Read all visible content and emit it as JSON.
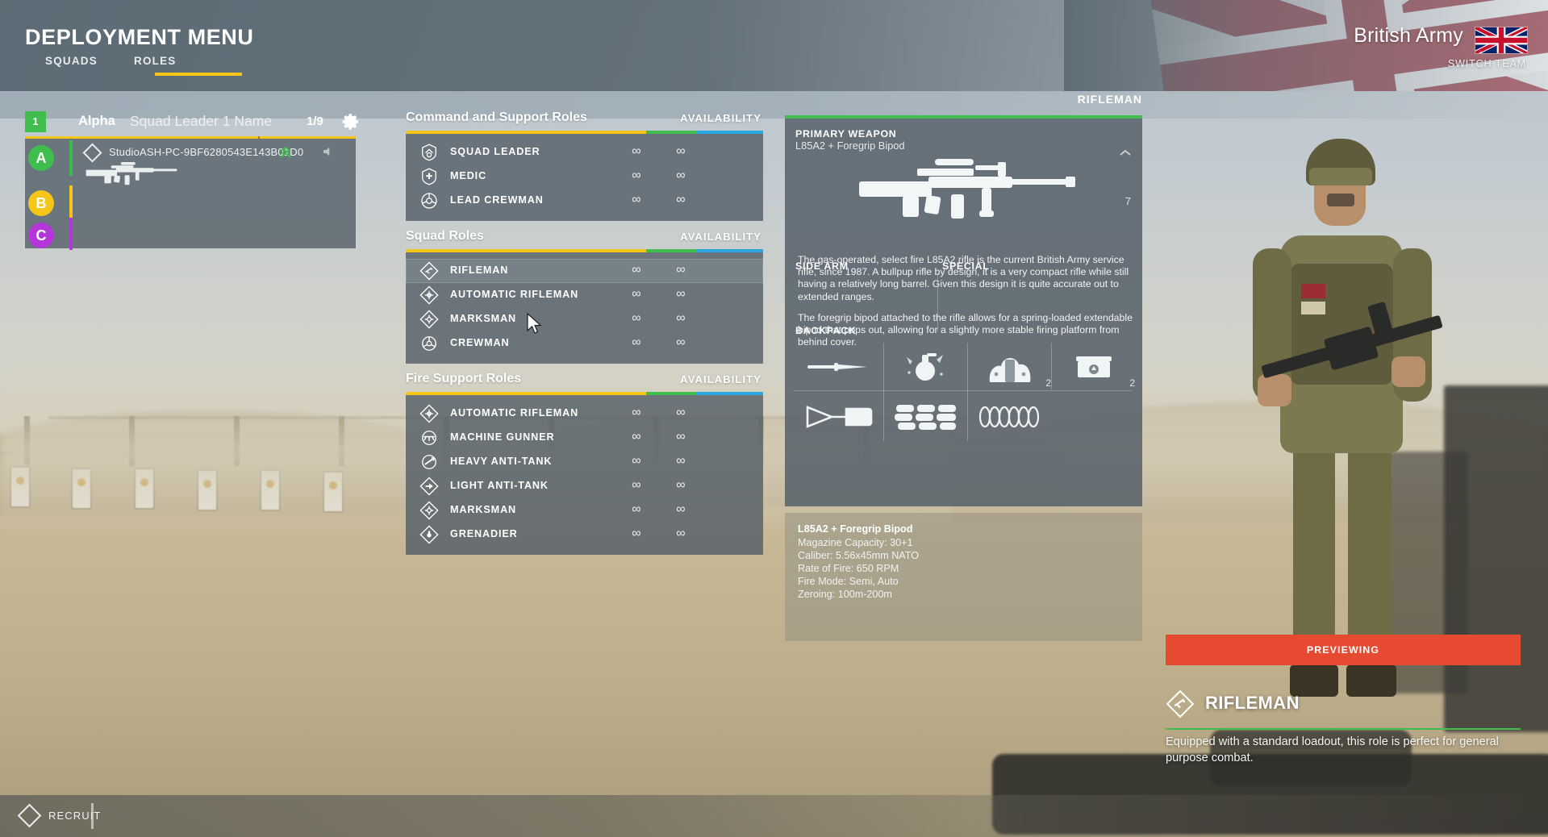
{
  "header": {
    "title": "DEPLOYMENT MENU",
    "tabs": [
      {
        "id": "squads",
        "label": "SQUADS",
        "active": false
      },
      {
        "id": "roles",
        "label": "ROLES",
        "active": true
      }
    ],
    "team_name": "British Army",
    "team_flag_icon": "union-jack-flag-icon",
    "switch_team_label": "SWITCH TEAM"
  },
  "squad_panel": {
    "squad_number": "1",
    "squad_name": "Alpha",
    "leader_label": "Squad Leader 1 Name",
    "capacity": "1/9",
    "settings_icon": "gear-icon",
    "fireteams": [
      {
        "letter": "A",
        "color": "#3fbe4d"
      },
      {
        "letter": "B",
        "color": "#f5c518"
      },
      {
        "letter": "C",
        "color": "#b336d8"
      }
    ],
    "members": [
      {
        "fireteam": "A",
        "name": "StudioASH-PC-9BF6280543E143B01D0",
        "rank_icon": "chevron-rank-icon",
        "mute_icon": "speaker-icon",
        "weapon_icon": "rifle-silhouette-icon"
      }
    ]
  },
  "role_sections": [
    {
      "id": "command-and-support",
      "title": "Command and Support Roles",
      "availability_label": "AVAILABILITY",
      "roles": [
        {
          "name": "SQUAD LEADER",
          "icon": "squad-leader-icon",
          "avail_1": "∞",
          "avail_2": "∞",
          "selected": false
        },
        {
          "name": "MEDIC",
          "icon": "medic-icon",
          "avail_1": "∞",
          "avail_2": "∞",
          "selected": false
        },
        {
          "name": "LEAD CREWMAN",
          "icon": "lead-crewman-icon",
          "avail_1": "∞",
          "avail_2": "∞",
          "selected": false
        }
      ]
    },
    {
      "id": "squad-roles",
      "title": "Squad Roles",
      "availability_label": "AVAILABILITY",
      "roles": [
        {
          "name": "RIFLEMAN",
          "icon": "rifleman-icon",
          "avail_1": "∞",
          "avail_2": "∞",
          "selected": true
        },
        {
          "name": "AUTOMATIC RIFLEMAN",
          "icon": "automatic-rifleman-icon",
          "avail_1": "∞",
          "avail_2": "∞",
          "selected": false
        },
        {
          "name": "MARKSMAN",
          "icon": "marksman-icon",
          "avail_1": "∞",
          "avail_2": "∞",
          "selected": false
        },
        {
          "name": "CREWMAN",
          "icon": "crewman-icon",
          "avail_1": "∞",
          "avail_2": "∞",
          "selected": false
        }
      ]
    },
    {
      "id": "fire-support-roles",
      "title": "Fire Support Roles",
      "availability_label": "AVAILABILITY",
      "roles": [
        {
          "name": "AUTOMATIC RIFLEMAN",
          "icon": "automatic-rifleman-icon",
          "avail_1": "∞",
          "avail_2": "∞",
          "selected": false
        },
        {
          "name": "MACHINE GUNNER",
          "icon": "machine-gunner-icon",
          "avail_1": "∞",
          "avail_2": "∞",
          "selected": false
        },
        {
          "name": "HEAVY ANTI-TANK",
          "icon": "heavy-anti-tank-icon",
          "avail_1": "∞",
          "avail_2": "∞",
          "selected": false
        },
        {
          "name": "LIGHT ANTI-TANK",
          "icon": "light-anti-tank-icon",
          "avail_1": "∞",
          "avail_2": "∞",
          "selected": false
        },
        {
          "name": "MARKSMAN",
          "icon": "marksman-icon",
          "avail_1": "∞",
          "avail_2": "∞",
          "selected": false
        },
        {
          "name": "GRENADIER",
          "icon": "grenadier-icon",
          "avail_1": "∞",
          "avail_2": "∞",
          "selected": false
        }
      ]
    }
  ],
  "loadout": {
    "role_title": "RIFLEMAN",
    "primary_label": "PRIMARY WEAPON",
    "primary_name": "L85A2 + Foregrip Bipod",
    "primary_weapon_icon": "rifle-l85a2-icon",
    "collapse_icon": "chevron-up-icon",
    "primary_slot_count": "7",
    "side_arm_label": "SIDE ARM",
    "special_label": "SPECIAL",
    "backpack_label": "BACKPACK",
    "backpack_items": [
      {
        "icon": "knife-icon",
        "qty": ""
      },
      {
        "icon": "frag-grenade-icon",
        "qty": ""
      },
      {
        "icon": "smoke-grenade-icon",
        "qty": "2"
      },
      {
        "icon": "ammo-bag-icon",
        "qty": "2"
      },
      {
        "icon": "shovel-icon",
        "qty": ""
      },
      {
        "icon": "sandbags-icon",
        "qty": ""
      },
      {
        "icon": "razor-wire-icon",
        "qty": ""
      }
    ],
    "weapon_info": {
      "title": "L85A2 + Foregrip Bipod",
      "stats": [
        "Magazine Capacity: 30+1",
        "Caliber: 5.56x45mm NATO",
        "Rate of Fire: 650 RPM",
        "Fire Mode: Semi, Auto",
        "Zeroing: 100m-200m"
      ],
      "paragraph_1": "The gas-operated, select fire L85A2 rifle is the current British Army service rifle, since 1987. A bullpup rifle by design, it is a very compact rifle while still having a relatively long barrel. Given this design it is quite accurate out to extended ranges.",
      "paragraph_2": "The foregrip bipod attached to the rifle allows for a spring-loaded extendable bipod that pops out, allowing for a slightly more stable firing platform from behind cover."
    }
  },
  "preview": {
    "button_label": "PREVIEWING",
    "button_color": "#e64a31",
    "role_name": "RIFLEMAN",
    "role_icon": "rifleman-icon",
    "accent_color": "#3fbe4d",
    "description": "Equipped with a standard loadout, this role is perfect for general purpose combat."
  },
  "bottom_bar": {
    "icon": "diamond-icon",
    "label": "RECRUIT"
  },
  "colors": {
    "accent_yellow": "#f5c518",
    "accent_green": "#3fbe4d",
    "accent_blue": "#2aa7e0",
    "panel": "rgba(84,95,104,.82)"
  }
}
